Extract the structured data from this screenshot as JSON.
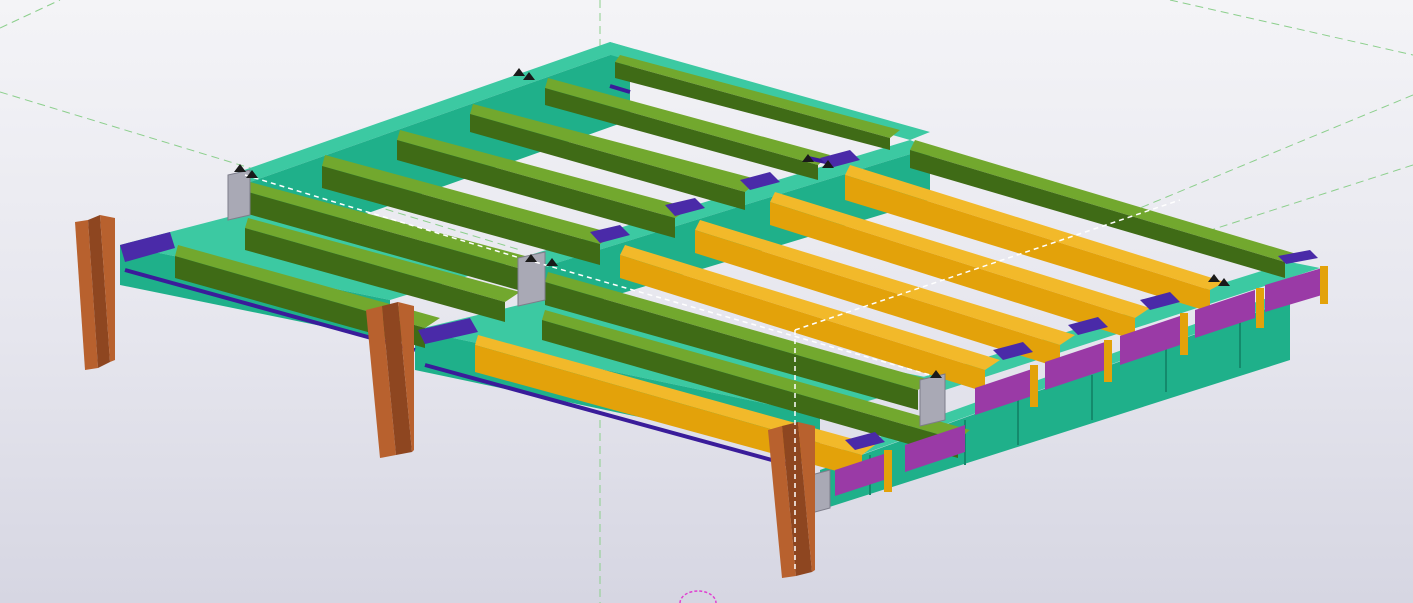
{
  "viewport": {
    "name": "3D model view",
    "background_top": "#f4f4f7",
    "background_bottom": "#d6d6e2"
  },
  "colors": {
    "girder_teal": "#1fb08a",
    "girder_teal_dark": "#148a6c",
    "girder_teal_light": "#3cc9a2",
    "beam_green": "#5a8f22",
    "beam_green_dark": "#3f6b16",
    "beam_green_light": "#72a82e",
    "beam_yellow": "#e3a20a",
    "beam_yellow_dark": "#b07d06",
    "beam_yellow_light": "#f2b92a",
    "column_brown": "#b8612e",
    "column_brown_dark": "#8e4620",
    "brace_purple": "#3a1c9a",
    "strut_violet": "#9a3aa6",
    "plate_gray": "#a9a9b5",
    "gridline_green": "#7fc77f",
    "gridline_white": "#ffffff",
    "work_plane_marker": "#e040d0"
  },
  "model": {
    "groups": [
      {
        "id": "upper-bay-green-beams",
        "color_key": "beam_green"
      },
      {
        "id": "lower-bay-yellow-beams",
        "color_key": "beam_yellow"
      },
      {
        "id": "teal-girders",
        "color_key": "girder_teal"
      },
      {
        "id": "columns",
        "color_key": "column_brown"
      },
      {
        "id": "bracing",
        "color_key": "brace_purple"
      },
      {
        "id": "edge-struts",
        "color_key": "strut_violet"
      }
    ]
  }
}
